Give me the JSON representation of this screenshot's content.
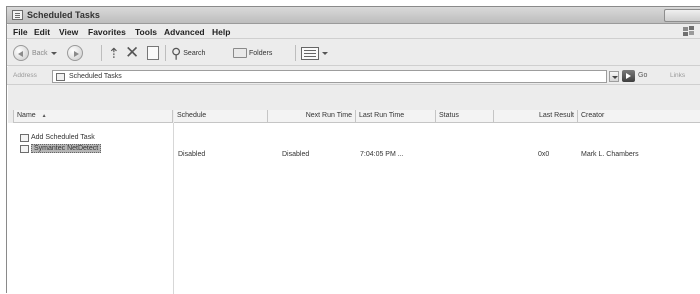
{
  "window": {
    "title": "Scheduled Tasks"
  },
  "menu": {
    "items": [
      "File",
      "Edit",
      "View",
      "Favorites",
      "Tools",
      "Advanced",
      "Help"
    ]
  },
  "toolbar": {
    "back_label": "Back",
    "search_label": "Search",
    "folders_label": "Folders"
  },
  "address": {
    "label": "Address",
    "value": "Scheduled Tasks",
    "go_label": "Go",
    "links_label": "Links"
  },
  "columns": [
    "Name",
    "Schedule",
    "Next Run Time",
    "Last Run Time",
    "Status",
    "Last Result",
    "Creator"
  ],
  "sort_indicator": "▲",
  "left_items": [
    {
      "label": "Add Scheduled Task"
    },
    {
      "label": "Symantec NetDetect"
    }
  ],
  "task": {
    "schedule": "Disabled",
    "next_run": "Disabled",
    "last_run": "7:04:05 PM ...",
    "status": "",
    "last_result": "0x0",
    "creator": "Mark L. Chambers"
  },
  "colors": {
    "window_bg": "#ececec",
    "selection": "#b5b5b5"
  }
}
